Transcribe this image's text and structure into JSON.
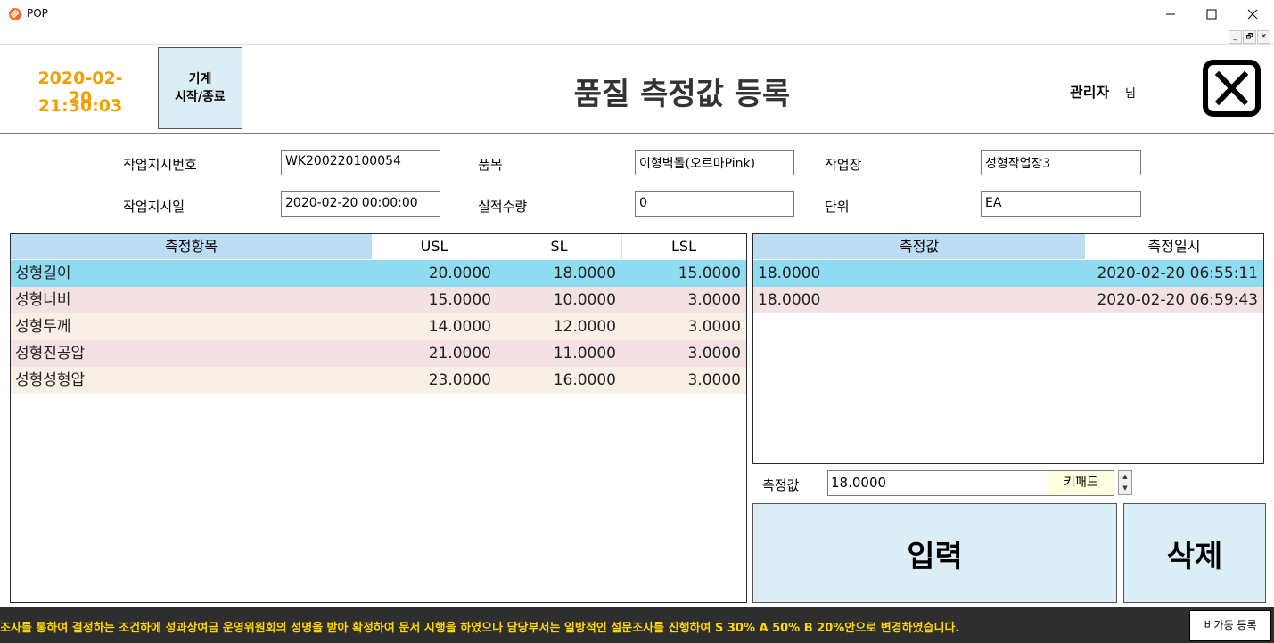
{
  "window": {
    "title": "POP",
    "minimize": "—",
    "maximize": "☐",
    "close": "✕"
  },
  "mdi": {
    "minimize": "_",
    "restore": "🗗",
    "close": "✕"
  },
  "header": {
    "date": "2020-02-20",
    "time": "21:30:03",
    "machine_button": {
      "line1": "기계",
      "line2": "시작/종료"
    },
    "title": "품질 측정값 등록",
    "user": "관리자",
    "user_suffix": "님"
  },
  "form": {
    "work_order_no": {
      "label": "작업지시번호",
      "value": "WK200220100054"
    },
    "work_order_date": {
      "label": "작업지시일",
      "value": "2020-02-20 00:00:00"
    },
    "item": {
      "label": "품목",
      "value": "이형벽돌(오르마Pink)"
    },
    "actual_qty": {
      "label": "실적수량",
      "value": "0"
    },
    "workshop": {
      "label": "작업장",
      "value": "성형작업장3"
    },
    "unit": {
      "label": "단위",
      "value": "EA"
    }
  },
  "items_grid": {
    "headers": [
      "측정항목",
      "USL",
      "SL",
      "LSL"
    ],
    "rows": [
      {
        "name": "성형길이",
        "usl": "20.0000",
        "sl": "18.0000",
        "lsl": "15.0000"
      },
      {
        "name": "성형너비",
        "usl": "15.0000",
        "sl": "10.0000",
        "lsl": "3.0000"
      },
      {
        "name": "성형두께",
        "usl": "14.0000",
        "sl": "12.0000",
        "lsl": "3.0000"
      },
      {
        "name": "성형진공압",
        "usl": "21.0000",
        "sl": "11.0000",
        "lsl": "3.0000"
      },
      {
        "name": "성형성형압",
        "usl": "23.0000",
        "sl": "16.0000",
        "lsl": "3.0000"
      }
    ]
  },
  "measure_grid": {
    "headers": [
      "측정값",
      "측정일시"
    ],
    "rows": [
      {
        "value": "18.0000",
        "datetime": "2020-02-20 06:55:11"
      },
      {
        "value": "18.0000",
        "datetime": "2020-02-20 06:59:43"
      }
    ]
  },
  "measure_input": {
    "label": "측정값",
    "value": "18.0000",
    "keypad": "키패드"
  },
  "buttons": {
    "input": "입력",
    "delete": "삭제"
  },
  "status": {
    "marquee": "조사를 통하여 결정하는 조건하에 성과상여금 운영위원회의 성명을 받아 확정하여 문서 시행을 하였으나 담당부서는 일방적인 설문조사를 진행하여 S 30% A 50% B 20%안으로 변경하였습니다.",
    "unmeasured_button": "비가동 등록"
  },
  "colors": {
    "selected_row": "#8fdcf0",
    "row_pink": "#f3e1e3",
    "row_cream": "#f8efe6",
    "header_blue": "#bcdcf3",
    "date_orange": "#f0a000",
    "button_blue": "#dbeef5"
  }
}
